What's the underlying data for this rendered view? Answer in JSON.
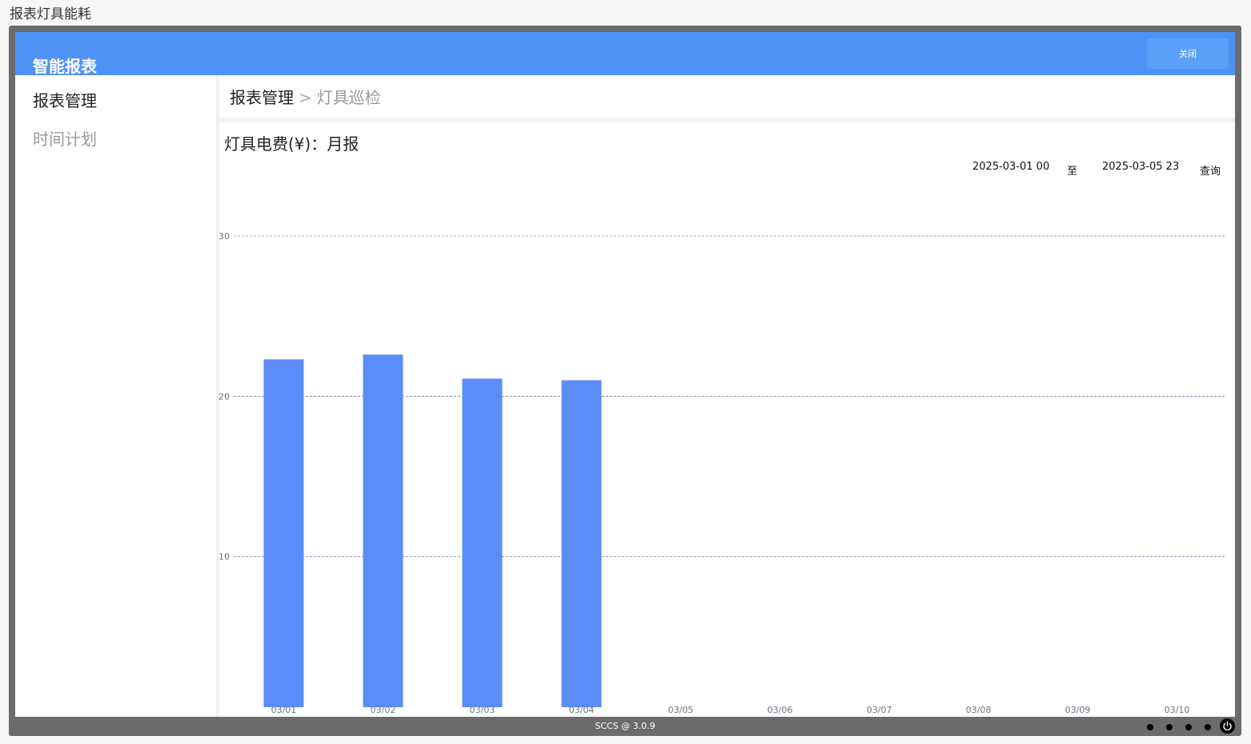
{
  "page_title": "报表灯具能耗",
  "header": {
    "app_title": "智能报表",
    "close_label": "关闭"
  },
  "sidebar": {
    "items": [
      {
        "label": "报表管理"
      },
      {
        "label": "时间计划"
      }
    ]
  },
  "breadcrumb": {
    "root": "报表管理",
    "separator": ">",
    "leaf": "灯具巡检"
  },
  "report": {
    "title": "灯具电费(¥)：月报",
    "start": "2025-03-01 00",
    "to_label": "至",
    "end": "2025-03-05 23",
    "query_label": "查询"
  },
  "chart_data": {
    "type": "bar",
    "categories": [
      "03/01",
      "03/02",
      "03/03",
      "03/04",
      "03/05",
      "03/06",
      "03/07",
      "03/08",
      "03/09",
      "03/10"
    ],
    "values": [
      22.3,
      22.6,
      21.1,
      21.0,
      0,
      0,
      0,
      0,
      0,
      0
    ],
    "ylim": [
      0,
      30
    ],
    "yticks": [
      0,
      10,
      20,
      30
    ],
    "grid": true,
    "bar_color": "#5b8cf8"
  },
  "footer": {
    "version": "SCCS @ 3.0.9"
  }
}
